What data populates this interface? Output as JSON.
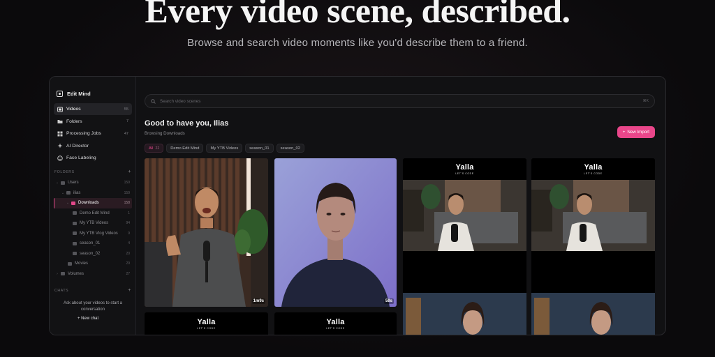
{
  "hero": {
    "title": "Every video scene, described.",
    "subtitle": "Browse and search video moments like you'd describe them to a friend."
  },
  "sidebar": {
    "brand": "Edit Mind",
    "nav": [
      {
        "label": "Videos",
        "count": "55",
        "icon": "film-icon",
        "active": true
      },
      {
        "label": "Folders",
        "count": "7",
        "icon": "folder-icon"
      },
      {
        "label": "Processing Jobs",
        "count": "47",
        "icon": "jobs-icon"
      },
      {
        "label": "AI Director",
        "count": "",
        "icon": "sparkle-icon"
      },
      {
        "label": "Face Labeling",
        "count": "",
        "icon": "face-icon"
      }
    ],
    "folders_label": "FOLDERS",
    "tree": [
      {
        "label": "Users",
        "count": "159",
        "depth": 0
      },
      {
        "label": "ilias",
        "count": "159",
        "depth": 1
      },
      {
        "label": "Downloads",
        "count": "158",
        "depth": 2,
        "active": true
      },
      {
        "label": "Demo Edit Mind",
        "count": "1",
        "depth": 3
      },
      {
        "label": "My YTB Videos",
        "count": "94",
        "depth": 3
      },
      {
        "label": "My YTB Vlog Videos",
        "count": "9",
        "depth": 3
      },
      {
        "label": "season_01",
        "count": "4",
        "depth": 3
      },
      {
        "label": "season_02",
        "count": "20",
        "depth": 3
      },
      {
        "label": "Movies",
        "count": "29",
        "depth": 2
      },
      {
        "label": "Volumes",
        "count": "27",
        "depth": 0
      }
    ],
    "chats_label": "CHATS",
    "chat_help": "Ask about your videos to start a conversation",
    "new_chat": "+ New chat"
  },
  "main": {
    "search_placeholder": "Search video scenes",
    "search_shortcut": "⌘K",
    "greeting": "Good to have you, Ilias",
    "browsing": "Browsing Downloads",
    "import_label": "New Import",
    "chips": [
      {
        "label": "All",
        "count": "22",
        "active": true
      },
      {
        "label": "Demo Edit Mind"
      },
      {
        "label": "My YTB Videos"
      },
      {
        "label": "season_01"
      },
      {
        "label": "season_02"
      }
    ],
    "cards": {
      "c1_duration": "1m9s",
      "c2_duration": "59s",
      "yalla_title": "Yalla",
      "yalla_sub": "LET'S CODE"
    }
  },
  "colors": {
    "accent": "#e9468a",
    "panel": "#111113"
  }
}
